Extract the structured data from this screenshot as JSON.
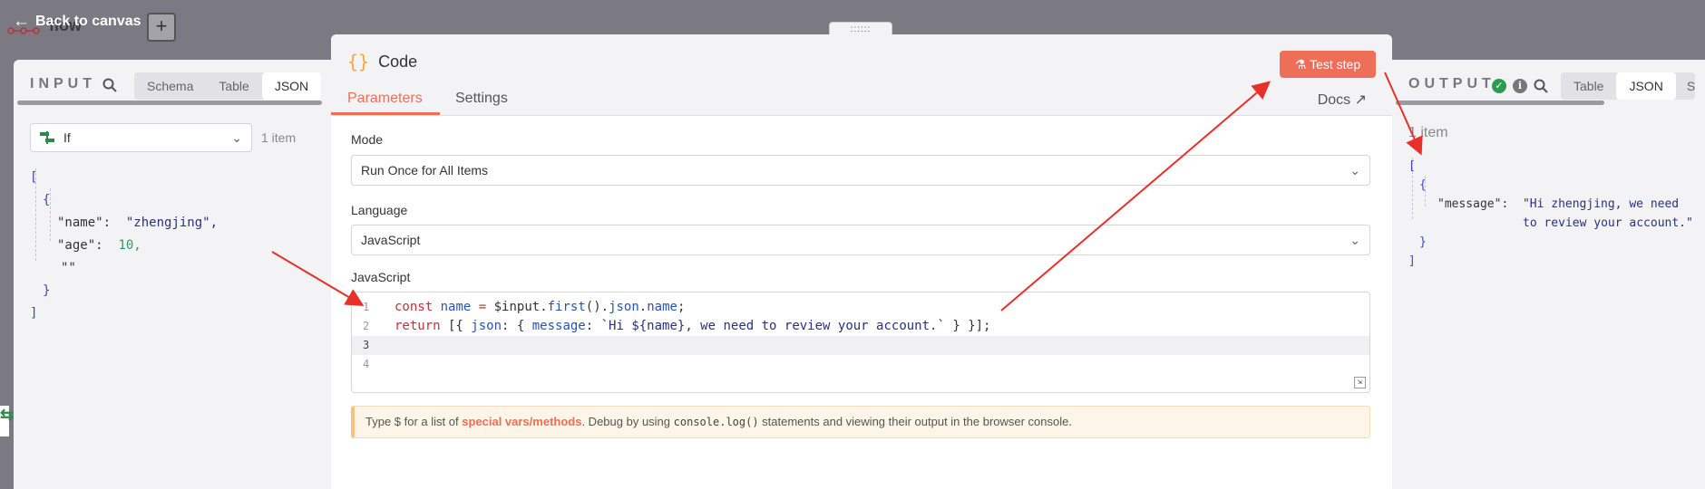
{
  "topbar": {
    "back_label": "Back to canvas",
    "workflow_name": "flow",
    "add_label": "+",
    "drag_handle": "::::::"
  },
  "input": {
    "title": "INPUT",
    "tabs": [
      "Schema",
      "Table",
      "JSON"
    ],
    "active_tab": "JSON",
    "node_select": "If",
    "items_count": "1 item",
    "json_lines": [
      "[",
      "{",
      "\"name\":",
      "\"zhengjing\",",
      "\"age\":",
      "10,",
      "\"\"",
      "}",
      "]"
    ]
  },
  "code_node": {
    "title": "Code",
    "icon": "{}",
    "test_button": "Test step",
    "tabs": [
      "Parameters",
      "Settings"
    ],
    "active_tab": "Parameters",
    "docs_label": "Docs",
    "mode_label": "Mode",
    "mode_value": "Run Once for All Items",
    "language_label": "Language",
    "language_value": "JavaScript",
    "editor_label": "JavaScript",
    "line_numbers": [
      "1",
      "2",
      "3",
      "4"
    ],
    "hint": {
      "prefix": "Type $ for a list of ",
      "link": "special vars/methods",
      "middle": ". Debug by using ",
      "code": "console.log()",
      "suffix": " statements and viewing their output in the browser console."
    }
  },
  "output": {
    "title": "OUTPUT",
    "tabs": [
      "Table",
      "JSON",
      "S"
    ],
    "active_tab": "JSON",
    "items_count": "1 item",
    "json_lines": [
      "[",
      "{",
      "\"message\":",
      "\"Hi zhengjing, we need",
      "to review your account.\"",
      "}",
      "]"
    ]
  },
  "colors": {
    "accent": "#ef6e58",
    "annotation": "#e8302a",
    "success": "#2d9a51"
  }
}
